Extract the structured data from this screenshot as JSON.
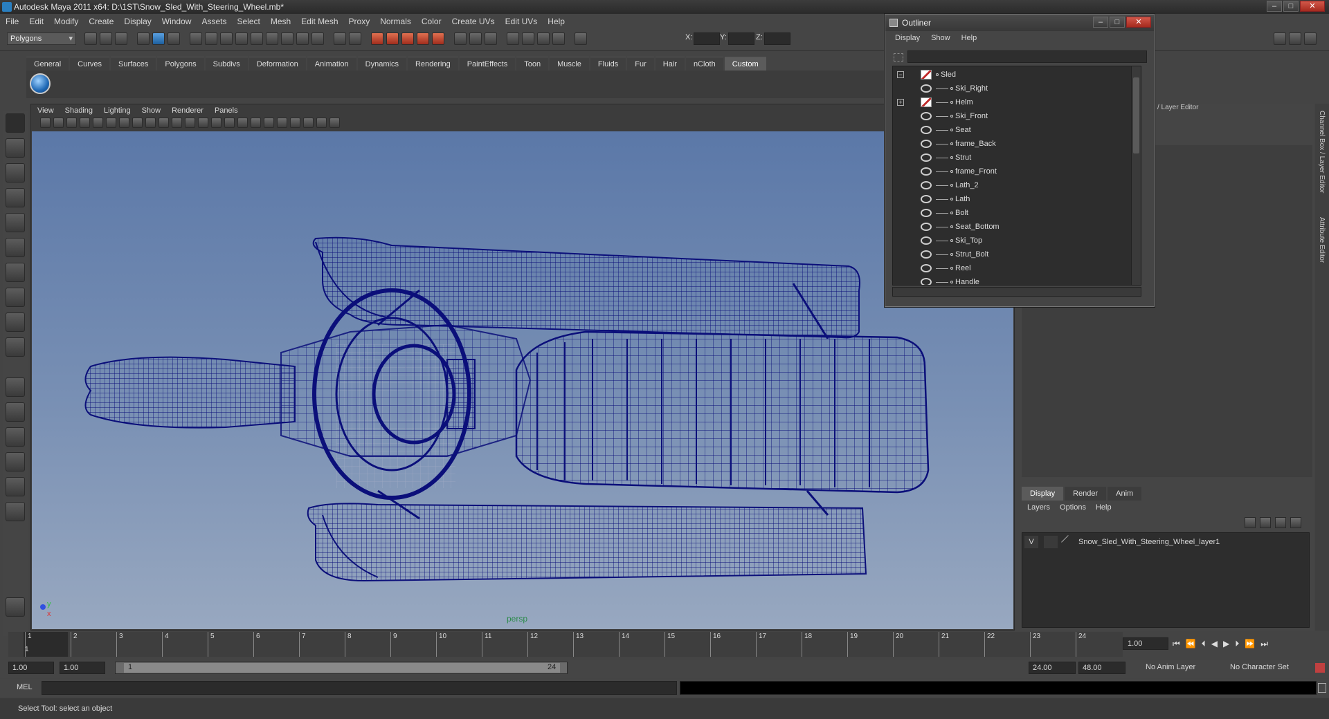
{
  "window": {
    "title": "Autodesk Maya 2011 x64: D:\\1ST\\Snow_Sled_With_Steering_Wheel.mb*"
  },
  "menubar": [
    "File",
    "Edit",
    "Modify",
    "Create",
    "Display",
    "Window",
    "Assets",
    "Select",
    "Mesh",
    "Edit Mesh",
    "Proxy",
    "Normals",
    "Color",
    "Create UVs",
    "Edit UVs",
    "Help"
  ],
  "toolbar": {
    "mode": "Polygons",
    "x_label": "X:",
    "y_label": "Y:",
    "z_label": "Z:"
  },
  "shelf_tabs": [
    "General",
    "Curves",
    "Surfaces",
    "Polygons",
    "Subdivs",
    "Deformation",
    "Animation",
    "Dynamics",
    "Rendering",
    "PaintEffects",
    "Toon",
    "Muscle",
    "Fluids",
    "Fur",
    "Hair",
    "nCloth",
    "Custom"
  ],
  "shelf_active": "Custom",
  "viewport": {
    "menu": [
      "View",
      "Shading",
      "Lighting",
      "Show",
      "Renderer",
      "Panels"
    ],
    "camera_label": "persp",
    "axis_y": "y",
    "axis_x": "x"
  },
  "outliner": {
    "title": "Outliner",
    "menu": [
      "Display",
      "Show",
      "Help"
    ],
    "root": "Sled",
    "items": [
      "Ski_Right",
      "Helm",
      "Ski_Front",
      "Seat",
      "frame_Back",
      "Strut",
      "frame_Front",
      "Lath_2",
      "Lath",
      "Bolt",
      "Seat_Bottom",
      "Ski_Top",
      "Strut_Bolt",
      "Reel",
      "Handle"
    ]
  },
  "right_panel": {
    "header": "/ Layer Editor",
    "vertical_tabs": [
      "Channel Box / Layer Editor",
      "Attribute Editor"
    ]
  },
  "layer_editor": {
    "tabs": [
      "Display",
      "Render",
      "Anim"
    ],
    "active_tab": "Display",
    "menu": [
      "Layers",
      "Options",
      "Help"
    ],
    "layer": {
      "visible": "V",
      "name": "Snow_Sled_With_Steering_Wheel_layer1"
    }
  },
  "timeline": {
    "ticks": [
      "1",
      "2",
      "3",
      "4",
      "5",
      "6",
      "7",
      "8",
      "9",
      "10",
      "11",
      "12",
      "13",
      "14",
      "15",
      "16",
      "17",
      "18",
      "19",
      "20",
      "21",
      "22",
      "23",
      "24"
    ],
    "current_frame": "1",
    "current_field": "1.00"
  },
  "range": {
    "start_a": "1.00",
    "start_b": "1.00",
    "slider_start": "1",
    "slider_end": "24",
    "end_a": "24.00",
    "end_b": "48.00",
    "anim_layer": "No Anim Layer",
    "character_set": "No Character Set"
  },
  "mel": {
    "label": "MEL"
  },
  "help_line": "Select Tool: select an object",
  "colors": {
    "wireframe": "#0b0f7a",
    "viewport_top": "#5b78a8",
    "viewport_bottom": "#98a8c0"
  }
}
